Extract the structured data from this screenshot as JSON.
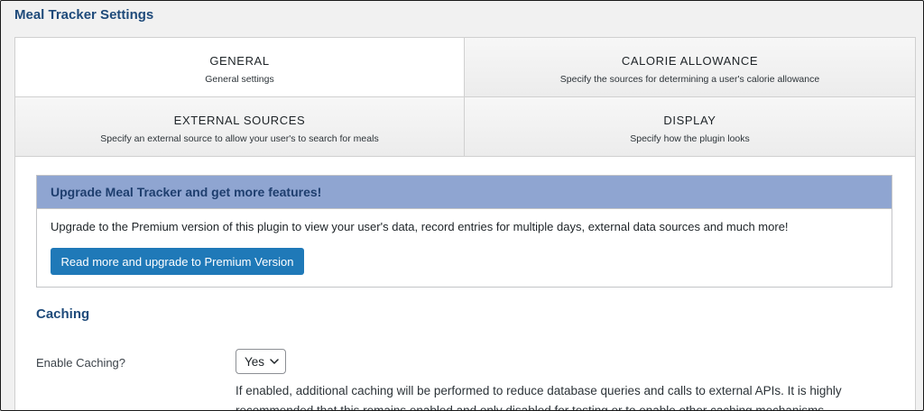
{
  "page": {
    "title": "Meal Tracker Settings"
  },
  "tabs": [
    {
      "label": "GENERAL",
      "description": "General settings",
      "active": true
    },
    {
      "label": "CALORIE ALLOWANCE",
      "description": "Specify the sources for determining a user's calorie allowance",
      "active": false
    },
    {
      "label": "EXTERNAL SOURCES",
      "description": "Specify an external source to allow your user's to search for meals",
      "active": false
    },
    {
      "label": "DISPLAY",
      "description": "Specify how the plugin looks",
      "active": false
    }
  ],
  "upgrade": {
    "heading": "Upgrade Meal Tracker and get more features!",
    "text": "Upgrade to the Premium version of this plugin to view your user's data, record entries for multiple days, external data sources and much more!",
    "button_label": "Read more and upgrade to Premium Version"
  },
  "caching": {
    "section_title": "Caching",
    "field_label": "Enable Caching?",
    "selected_value": "Yes",
    "help_text": "If enabled, additional caching will be performed to reduce database queries and calls to external APIs. It is highly recommended that this remains enabled and only disabled for testing or to enable other caching mechanisms."
  },
  "icons": {
    "select_chevron": "chevron-down-icon"
  },
  "colors": {
    "title": "#1e4a7a",
    "upgrade_header_bg": "#8fa5d1",
    "primary_button": "#1f79b8",
    "page_bg": "#f1f1f1"
  }
}
